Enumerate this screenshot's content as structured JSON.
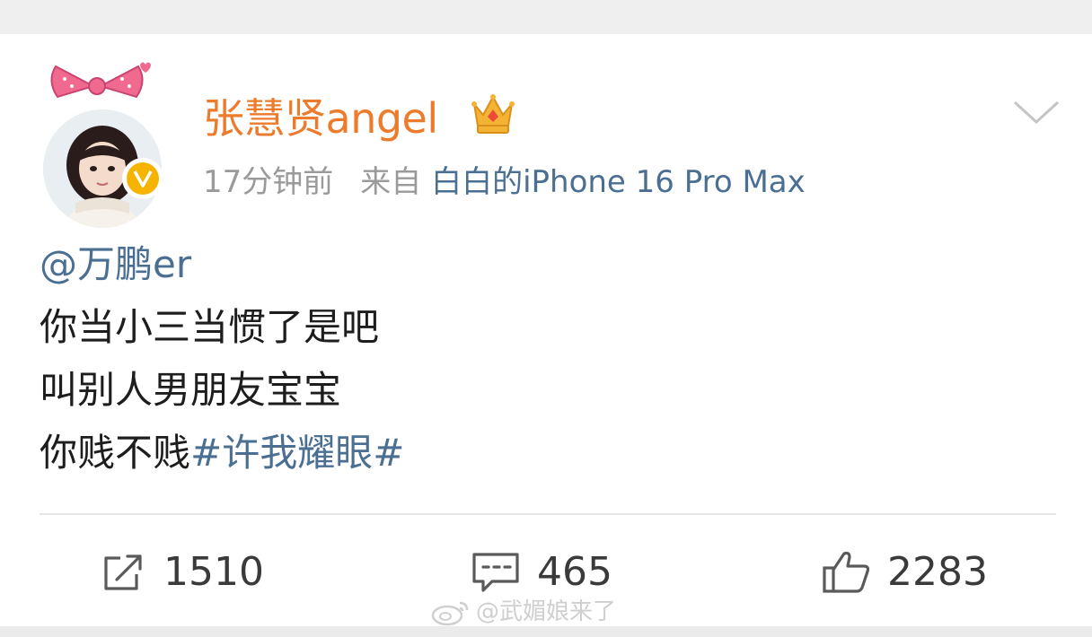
{
  "post": {
    "username": "张慧贤angel",
    "time": "17分钟前",
    "source_prefix": "来自",
    "device": "白白的iPhone 16 Pro Max",
    "mention": "@万鹏er",
    "lines": [
      "你当小三当惯了是吧",
      "叫别人男朋友宝宝",
      "你贱不贱"
    ],
    "hashtag": "#许我耀眼#"
  },
  "actions": {
    "share_count": "1510",
    "comment_count": "465",
    "like_count": "2283"
  },
  "watermark": "@武媚娘来了",
  "icons": [
    "bow-icon",
    "verified-badge-icon",
    "crown-icon",
    "chevron-down-icon",
    "share-icon",
    "comment-icon",
    "like-icon",
    "weibo-logo-icon"
  ],
  "colors": {
    "username": "#ed7b2c",
    "link": "#4a6f93",
    "meta": "#9a9a9a",
    "text": "#1d1d1d"
  }
}
